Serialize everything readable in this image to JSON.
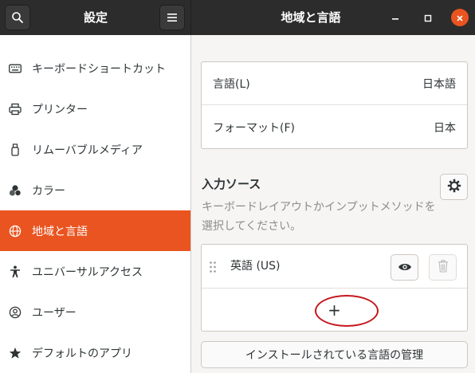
{
  "header": {
    "left_title": "設定",
    "right_title": "地域と言語"
  },
  "sidebar": {
    "items": [
      {
        "label": "キーボードショートカット",
        "icon": "keyboard-icon"
      },
      {
        "label": "プリンター",
        "icon": "printer-icon"
      },
      {
        "label": "リムーバブルメディア",
        "icon": "usb-drive-icon"
      },
      {
        "label": "カラー",
        "icon": "color-icon"
      },
      {
        "label": "地域と言語",
        "icon": "globe-icon",
        "active": true
      },
      {
        "label": "ユニバーサルアクセス",
        "icon": "accessibility-icon"
      },
      {
        "label": "ユーザー",
        "icon": "user-icon"
      },
      {
        "label": "デフォルトのアプリ",
        "icon": "star-icon"
      }
    ]
  },
  "main": {
    "language_label": "言語(L)",
    "language_value": "日本語",
    "format_label": "フォーマット(F)",
    "format_value": "日本",
    "input_sources_title": "入力ソース",
    "input_sources_desc": "キーボードレイアウトかインプットメソッドを選択してください。",
    "sources": [
      {
        "label": "英語 (US)"
      }
    ],
    "add_symbol": "+",
    "manage_button": "インストールされている言語の管理"
  },
  "colors": {
    "accent": "#e95420",
    "headerbar": "#2c2c2c",
    "annotation": "#c4171d"
  }
}
